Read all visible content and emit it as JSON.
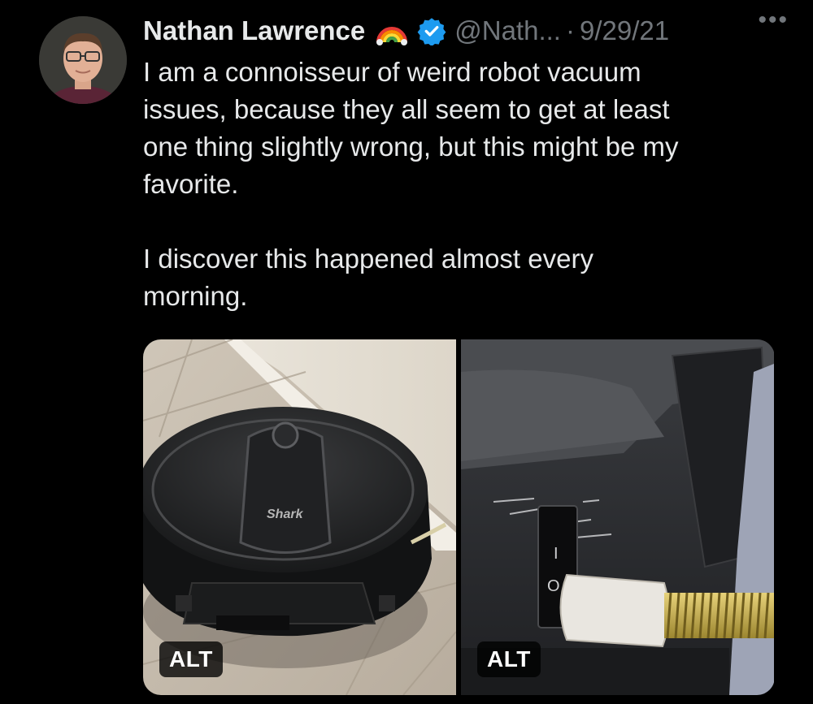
{
  "tweet": {
    "author_name": "Nathan Lawrence",
    "handle": "@Nath...",
    "separator": "·",
    "date": "9/29/21",
    "more": "•••",
    "icons": {
      "rainbow": "rainbow-emoji",
      "verified": "verified-badge-icon",
      "more": "more-options-icon"
    },
    "text_paragraph_1": [
      "I am a connoisseur of weird robot vacuum",
      "issues, because they all seem to get at least",
      "one thing slightly wrong, but this might be my",
      "favorite."
    ],
    "text_paragraph_2": [
      "I discover this happened almost every",
      "morning."
    ],
    "media": [
      {
        "alt_label": "ALT",
        "logo_text": "Shark"
      },
      {
        "alt_label": "ALT",
        "switch_on": "I",
        "switch_off": "O"
      }
    ]
  },
  "colors": {
    "background": "#000000",
    "text_primary": "#e7e9ea",
    "text_secondary": "#71767b",
    "verified_blue": "#1d9bf0"
  }
}
